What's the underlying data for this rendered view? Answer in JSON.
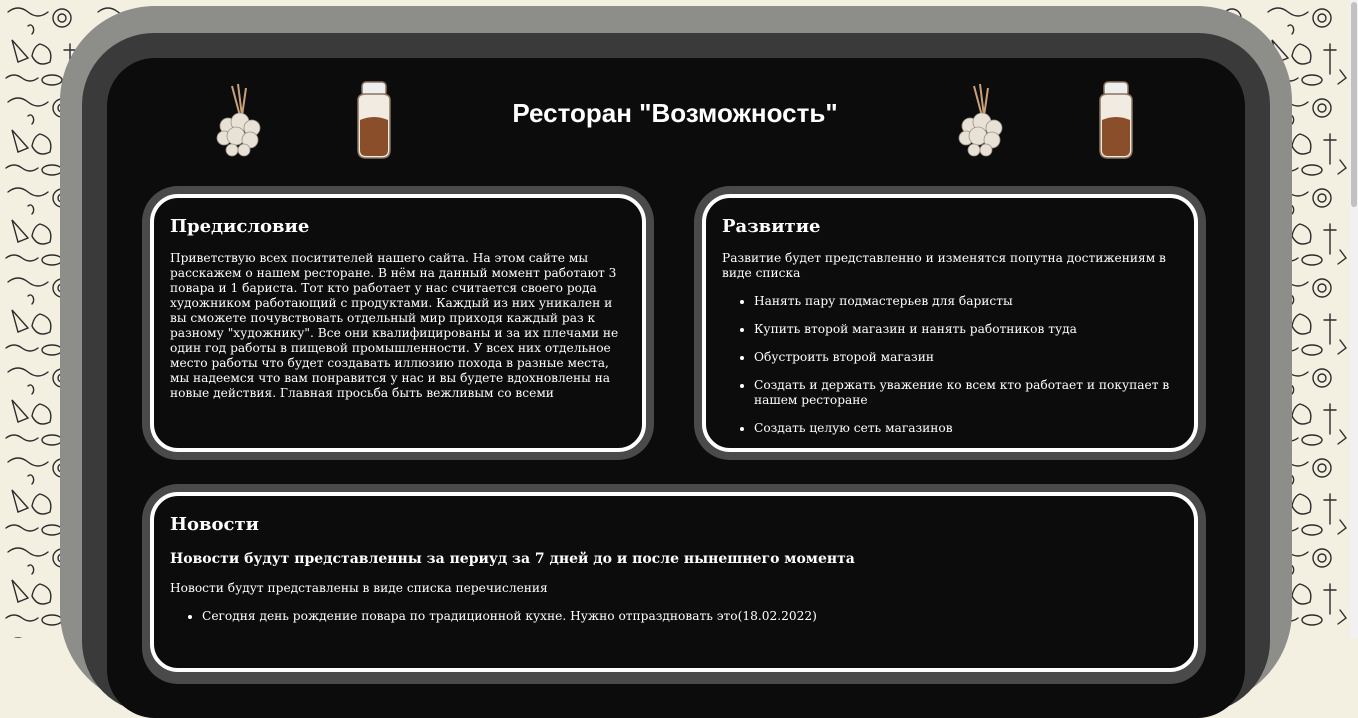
{
  "header": {
    "title": "Ресторан \"Возможность\"",
    "decorations": [
      "herb-bundle-icon",
      "spice-jar-icon",
      "herb-bundle-icon",
      "spice-jar-icon"
    ]
  },
  "preface": {
    "title": "Предисловие",
    "text": "Приветствую всех поситителей нашего сайта. На этом сайте мы расскажем о нашем ресторане. В нём на данный момент работают 3 повара и 1 бариста. Тот кто работает у нас считается своего рода художником работающий с продуктами. Каждый из них уникален и вы сможете почувствовать отдельный мир приходя каждый раз к разному \"художнику\". Все они квалифицированы и за их плечами не один год работы в пищевой промышленности. У всех них отдельное место работы что будет создавать иллюзию похода в разные места, мы надеемся что вам понравится у нас и вы будете вдохновлены на новые действия. Главная просьба быть вежливым со всеми"
  },
  "development": {
    "title": "Развитие",
    "intro": "Развитие будет представленно и изменятся попутна достижениям в виде списка",
    "items": [
      "Нанять пару подмастерьев для баристы",
      "Купить второй магазин и нанять работников туда",
      "Обустроить второй магазин",
      "Создать и держать уважение ко всем кто работает и покупает в нашем ресторане",
      "Создать целую сеть магазинов"
    ]
  },
  "news": {
    "title": "Новости",
    "subtitle": "Новости будут представленны за периуд за 7 дней до и после нынешнего момента",
    "intro": "Новости будут представлены в виде списка перечисления",
    "items": [
      "Сегодня день рождение повара по традиционной кухне. Нужно отпраздновать это(18.02.2022)"
    ]
  },
  "colors": {
    "page_bg": "#f3f0e2",
    "frame_outer": "#8d8d8a",
    "frame_mid": "#3a3a3a",
    "frame_inner": "#0c0c0c",
    "card_border": "#ffffff",
    "text": "#ffffff"
  }
}
